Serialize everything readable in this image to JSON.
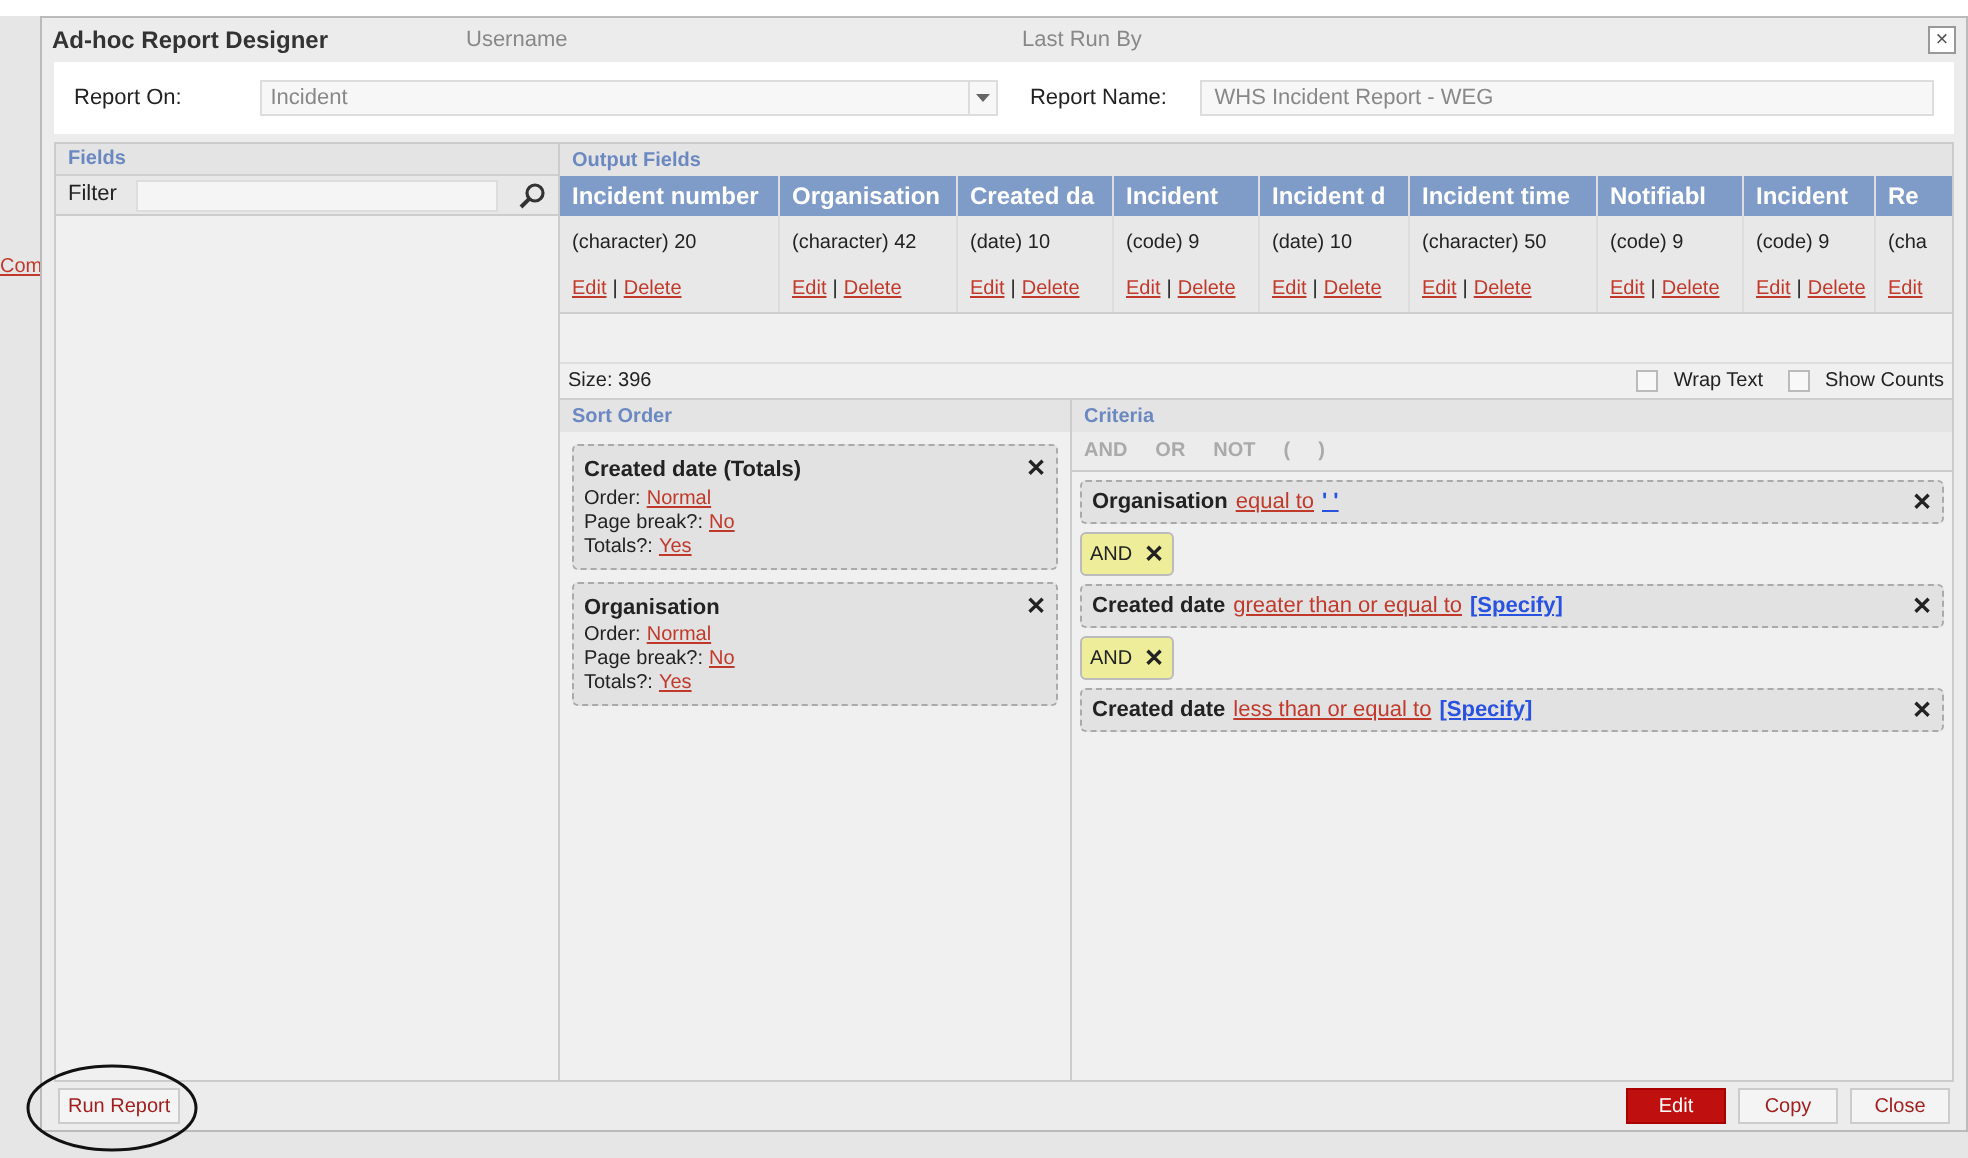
{
  "background": {
    "texts": [
      "Username",
      "Last Run By"
    ],
    "link": "Com"
  },
  "window": {
    "title": "Ad-hoc Report Designer",
    "close": "×"
  },
  "report_on": {
    "label": "Report On:",
    "value": "Incident"
  },
  "report_name": {
    "label": "Report Name:",
    "value": "WHS Incident Report - WEG"
  },
  "fields": {
    "title": "Fields",
    "filter_label": "Filter"
  },
  "output_fields": {
    "title": "Output Fields",
    "columns": [
      {
        "header": "Incident number",
        "type": "(character) 20",
        "edit": "Edit",
        "delete": "Delete"
      },
      {
        "header": "Organisation",
        "type": "(character) 42",
        "edit": "Edit",
        "delete": "Delete"
      },
      {
        "header": "Created da",
        "type": "(date) 10",
        "edit": "Edit",
        "delete": "Delete"
      },
      {
        "header": "Incident",
        "type": "(code) 9",
        "edit": "Edit",
        "delete": "Delete"
      },
      {
        "header": "Incident d",
        "type": "(date) 10",
        "edit": "Edit",
        "delete": "Delete"
      },
      {
        "header": "Incident time",
        "type": "(character) 50",
        "edit": "Edit",
        "delete": "Delete"
      },
      {
        "header": "Notifiabl",
        "type": "(code) 9",
        "edit": "Edit",
        "delete": "Delete"
      },
      {
        "header": "Incident",
        "type": "(code) 9",
        "edit": "Edit",
        "delete": "Delete"
      },
      {
        "header": "Re",
        "type": "(cha",
        "edit": "Edit"
      }
    ],
    "size": "Size: 396",
    "separator": "|",
    "options": [
      {
        "label": "Wrap Text",
        "checked": false
      },
      {
        "label": "Show Counts",
        "checked": false
      }
    ]
  },
  "sort_order": {
    "title": "Sort Order",
    "items": [
      {
        "title": "Created date (Totals)",
        "close": "✕",
        "lines": [
          {
            "label": "Order:",
            "value": "Normal"
          },
          {
            "label": "Page break?:",
            "value": "No"
          },
          {
            "label": "Totals?:",
            "value": "Yes"
          }
        ]
      },
      {
        "title": "Organisation",
        "close": "✕",
        "lines": [
          {
            "label": "Order:",
            "value": "Normal"
          },
          {
            "label": "Page break?:",
            "value": "No"
          },
          {
            "label": "Totals?:",
            "value": "Yes"
          }
        ]
      }
    ]
  },
  "criteria": {
    "title": "Criteria",
    "toolbar": [
      "AND",
      "OR",
      "NOT",
      "(",
      ")"
    ],
    "items": [
      {
        "kind": "condition",
        "field": "Organisation",
        "operator": "equal to",
        "value": "' '",
        "close": "✕"
      },
      {
        "kind": "operator",
        "label": "AND",
        "close": "✕"
      },
      {
        "kind": "condition",
        "field": "Created date",
        "operator": "greater than or equal to",
        "value": "[Specify]",
        "close": "✕"
      },
      {
        "kind": "operator",
        "label": "AND",
        "close": "✕"
      },
      {
        "kind": "condition",
        "field": "Created date",
        "operator": "less than or equal to",
        "value": "[Specify]",
        "close": "✕"
      }
    ]
  },
  "footer": {
    "run": "Run Report",
    "buttons": [
      {
        "label": "Edit",
        "primary": true
      },
      {
        "label": "Copy",
        "primary": false
      },
      {
        "label": "Close",
        "primary": false
      }
    ]
  }
}
